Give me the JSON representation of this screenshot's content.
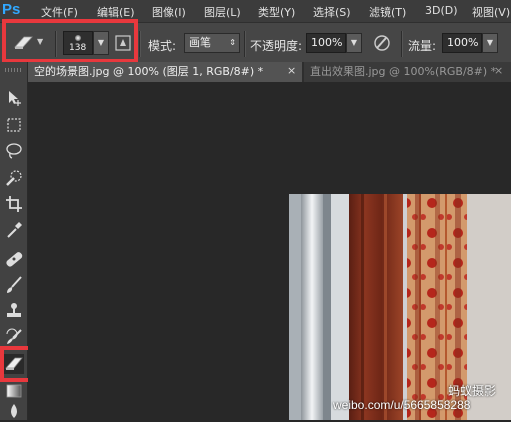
{
  "menubar": {
    "logo": "Ps",
    "items": [
      "文件(F)",
      "编辑(E)",
      "图像(I)",
      "图层(L)",
      "类型(Y)",
      "选择(S)",
      "滤镜(T)",
      "3D(D)",
      "视图(V)"
    ]
  },
  "options": {
    "tool_icon": "eraser-icon",
    "brush_size": "138",
    "mode_label": "模式:",
    "mode_value": "画笔",
    "opacity_label": "不透明度:",
    "opacity_value": "100%",
    "flow_label": "流量:",
    "flow_value": "100%"
  },
  "tabs": [
    {
      "label": "空的场景图.jpg @ 100% (图层 1, RGB/8#) *",
      "close": "×",
      "active": true
    },
    {
      "label": "直出效果图.jpg @ 100%(RGB/8#) *",
      "close": "×",
      "active": false
    }
  ],
  "toolbar": {
    "tools": [
      "move-tool",
      "marquee-tool",
      "lasso-tool",
      "quick-selection-tool",
      "crop-tool",
      "eyedropper-tool",
      "healing-brush-tool",
      "brush-tool",
      "clone-stamp-tool",
      "history-brush-tool",
      "eraser-tool",
      "gradient-tool",
      "blur-tool"
    ],
    "selected": "eraser-tool"
  },
  "canvas": {
    "watermark_name": "蚂蚁摄影",
    "watermark_url": "weibo.com/u/5665858288"
  },
  "highlight_color": "#e8383d",
  "accent_color": "#31a8ff"
}
